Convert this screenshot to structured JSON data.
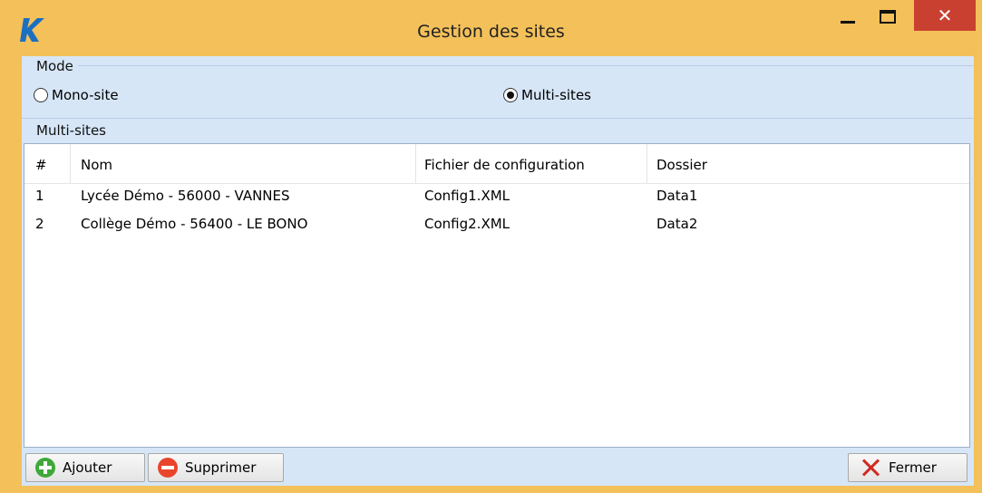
{
  "window": {
    "title": "Gestion des sites",
    "close_glyph": "✕"
  },
  "mode": {
    "group_label": "Mode",
    "options": [
      {
        "label": "Mono-site",
        "selected": false
      },
      {
        "label": "Multi-sites",
        "selected": true
      }
    ]
  },
  "multisites": {
    "group_label": "Multi-sites",
    "columns": [
      "#",
      "Nom",
      "Fichier de configuration",
      "Dossier"
    ],
    "rows": [
      {
        "num": "1",
        "nom": "Lycée Démo - 56000 - VANNES",
        "fichier": "Config1.XML",
        "dossier": "Data1"
      },
      {
        "num": "2",
        "nom": "Collège Démo - 56400 - LE BONO",
        "fichier": "Config2.XML",
        "dossier": "Data2"
      }
    ]
  },
  "toolbar": {
    "add_label": "Ajouter",
    "delete_label": "Supprimer",
    "close_label": "Fermer"
  },
  "icons": {
    "app": "k-logo-icon",
    "add": "plus-circle-icon",
    "delete": "minus-circle-icon",
    "close": "x-icon"
  },
  "colors": {
    "titlebar": "#f3c05a",
    "client": "#d6e6f7",
    "close_button": "#c94030",
    "logo": "#1b6fc0"
  }
}
